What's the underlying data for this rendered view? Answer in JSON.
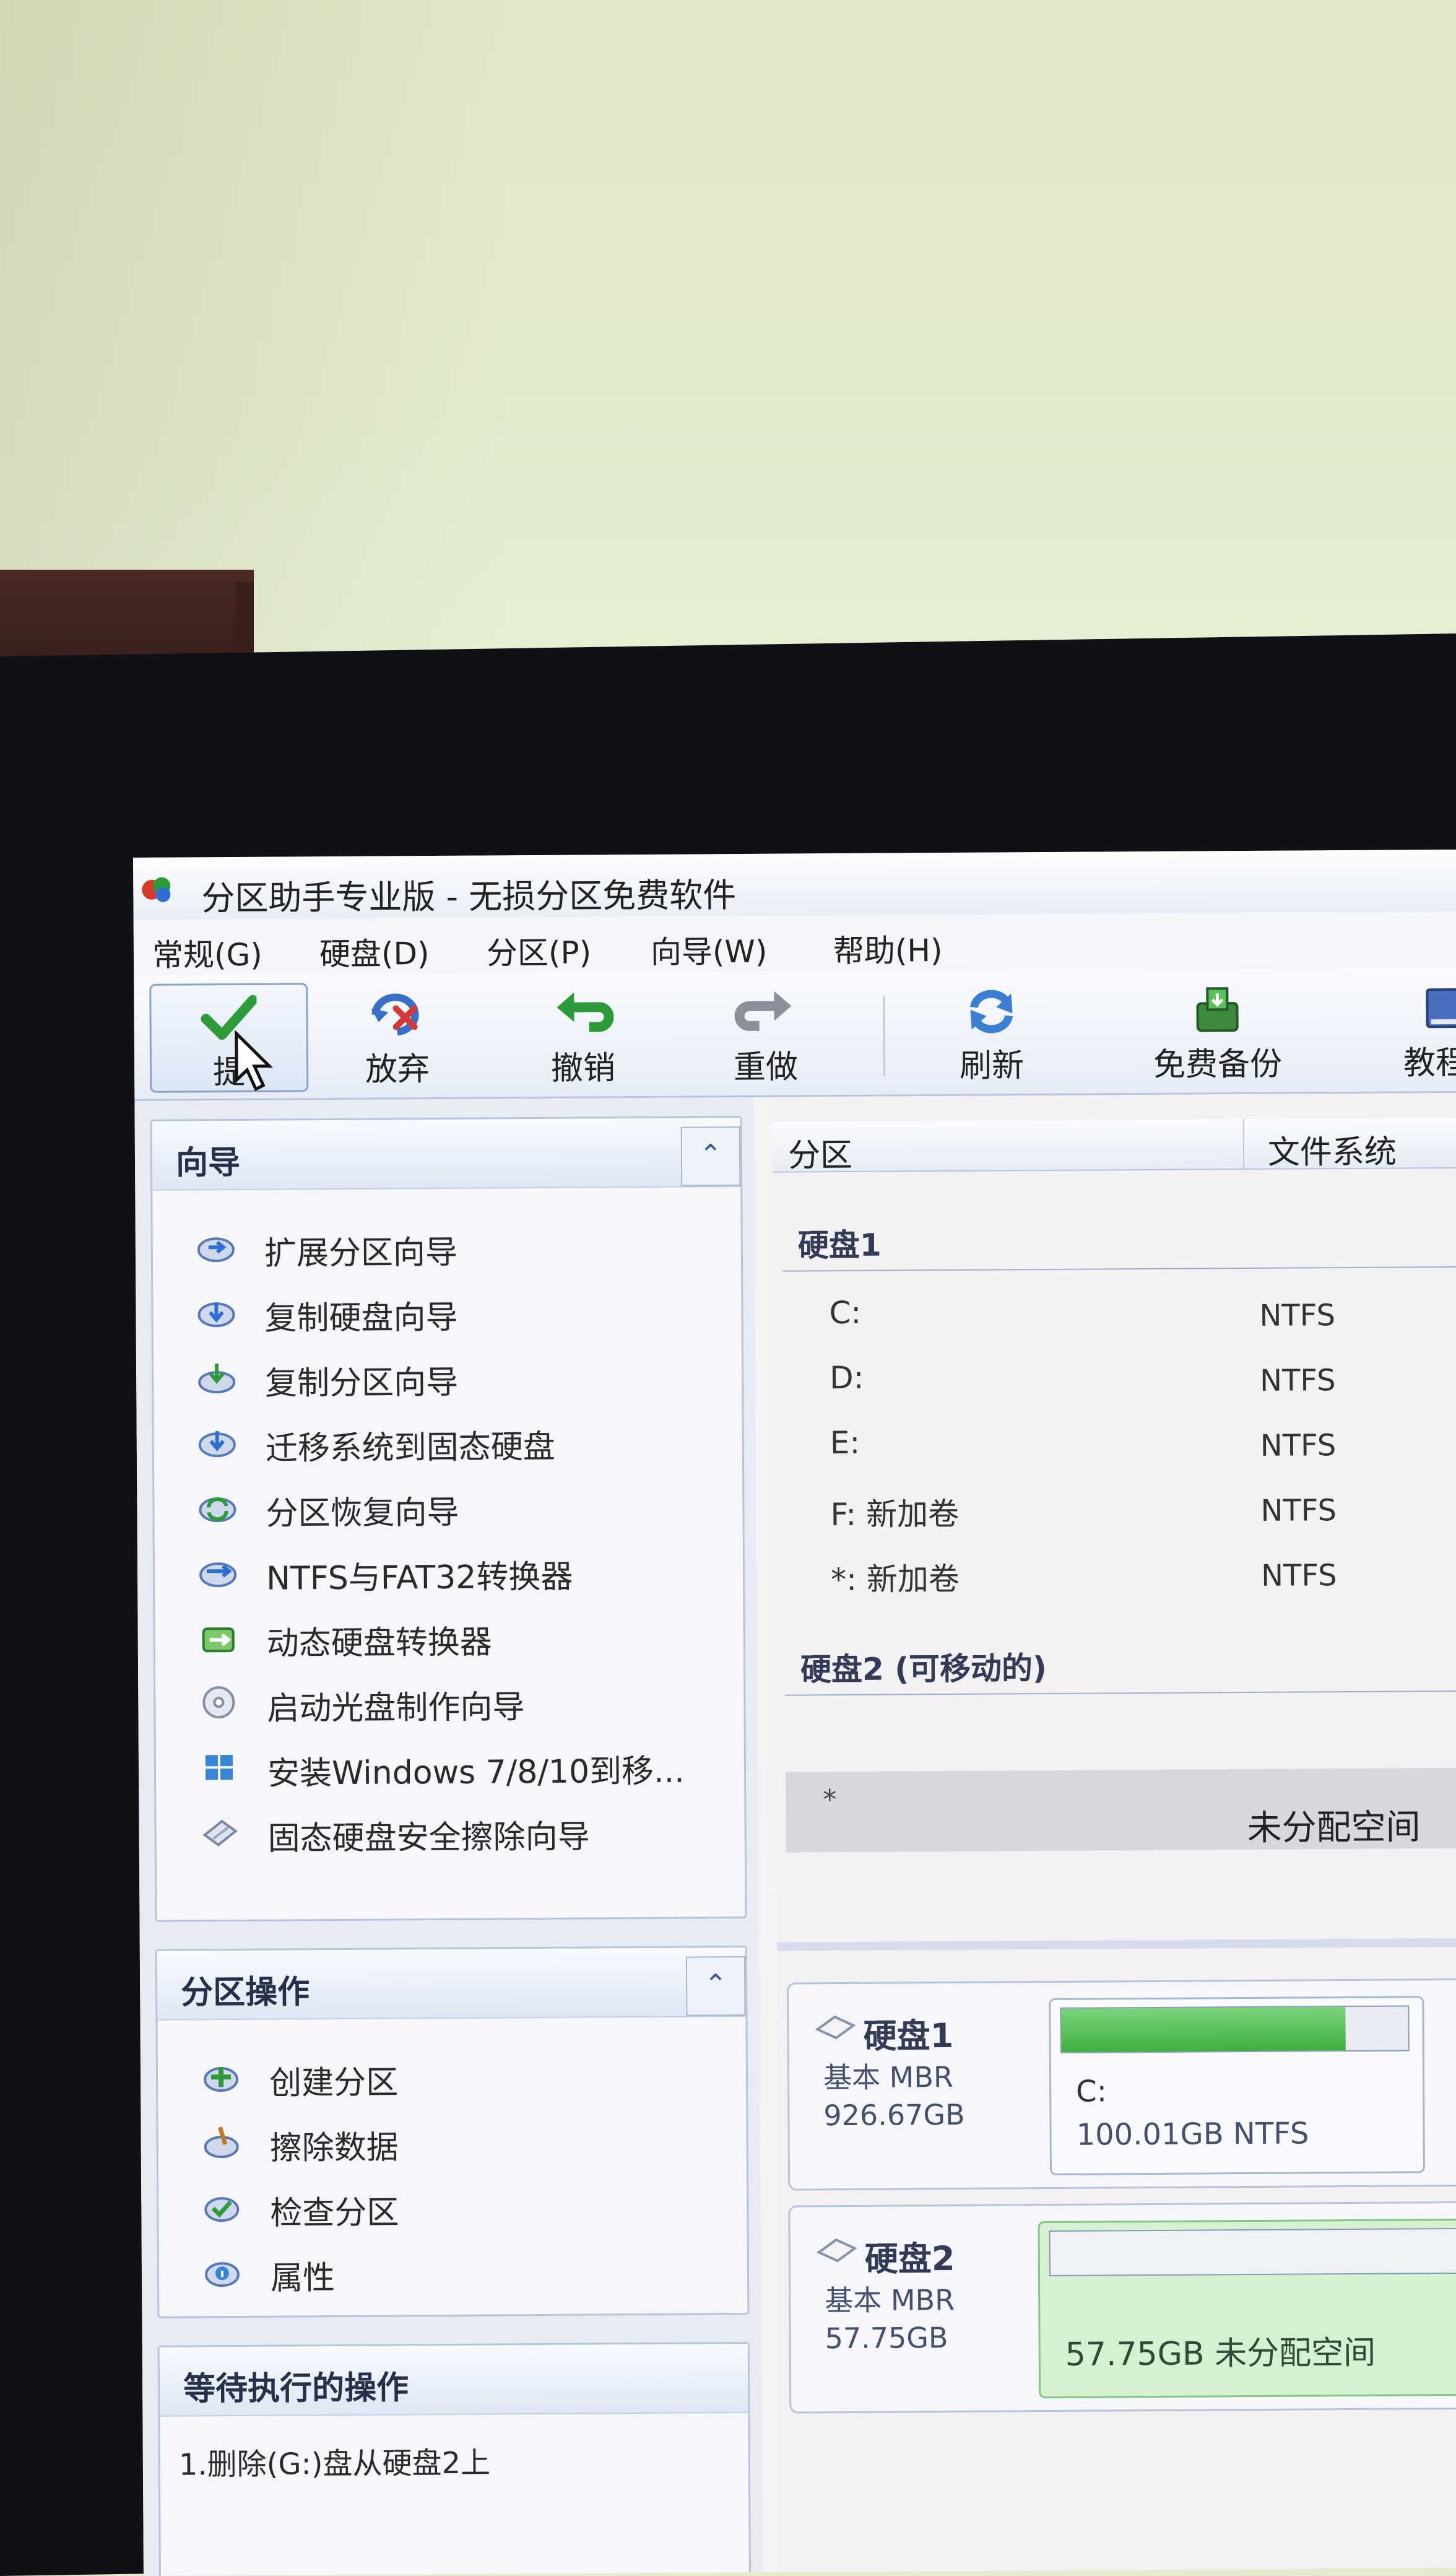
{
  "window": {
    "title": "分区助手专业版 - 无损分区免费软件"
  },
  "menu": [
    "常规(G)",
    "硬盘(D)",
    "分区(P)",
    "向导(W)",
    "帮助(H)"
  ],
  "toolbar": {
    "commit": "提交",
    "commit_visible": "提",
    "discard": "放弃",
    "undo": "撤销",
    "redo": "重做",
    "refresh": "刷新",
    "backup": "免费备份",
    "tutorial": "教程"
  },
  "wizard_panel": {
    "title": "向导",
    "items": [
      {
        "label": "扩展分区向导",
        "icon": "extend-partition-icon"
      },
      {
        "label": "复制硬盘向导",
        "icon": "copy-disk-icon"
      },
      {
        "label": "复制分区向导",
        "icon": "copy-partition-icon"
      },
      {
        "label": "迁移系统到固态硬盘",
        "icon": "migrate-os-icon"
      },
      {
        "label": "分区恢复向导",
        "icon": "partition-recovery-icon"
      },
      {
        "label": "NTFS与FAT32转换器",
        "icon": "ntfs-fat32-icon"
      },
      {
        "label": "动态硬盘转换器",
        "icon": "dynamic-disk-icon"
      },
      {
        "label": "启动光盘制作向导",
        "icon": "bootable-disc-icon"
      },
      {
        "label": "安装Windows 7/8/10到移...",
        "icon": "windows-to-go-icon"
      },
      {
        "label": "固态硬盘安全擦除向导",
        "icon": "ssd-erase-icon"
      }
    ]
  },
  "partition_ops_panel": {
    "title": "分区操作",
    "items": [
      {
        "label": "创建分区",
        "icon": "create-partition-icon"
      },
      {
        "label": "擦除数据",
        "icon": "wipe-data-icon"
      },
      {
        "label": "检查分区",
        "icon": "check-partition-icon"
      },
      {
        "label": "属性",
        "icon": "properties-icon"
      }
    ]
  },
  "pending_panel": {
    "title": "等待执行的操作",
    "items": [
      "1.删除(G:)盘从硬盘2上"
    ]
  },
  "partition_table": {
    "columns": {
      "partition": "分区",
      "filesystem": "文件系统"
    },
    "disk1_label": "硬盘1",
    "disk1_partitions": [
      {
        "name": "C:",
        "fs": "NTFS"
      },
      {
        "name": "D:",
        "fs": "NTFS"
      },
      {
        "name": "E:",
        "fs": "NTFS"
      },
      {
        "name": "F: 新加卷",
        "fs": "NTFS"
      },
      {
        "name": "*: 新加卷",
        "fs": "NTFS"
      }
    ],
    "disk2_label": "硬盘2 (可移动的)",
    "disk2_row": {
      "name": "*",
      "status": "未分配空间"
    }
  },
  "disk_map": [
    {
      "name": "硬盘1",
      "type": "基本 MBR",
      "size": "926.67GB",
      "segment": {
        "letter": "C:",
        "info": "100.01GB NTFS",
        "used_fraction": 0.82
      }
    },
    {
      "name": "硬盘2",
      "type": "基本 MBR",
      "size": "57.75GB",
      "segment": {
        "info": "57.75GB 未分配空间"
      }
    }
  ],
  "colors": {
    "commit_check": "#2e9a3a",
    "discard_red": "#d23a3a",
    "used_bar": "#3fae3f",
    "unallocated": "#d6f0d2"
  }
}
